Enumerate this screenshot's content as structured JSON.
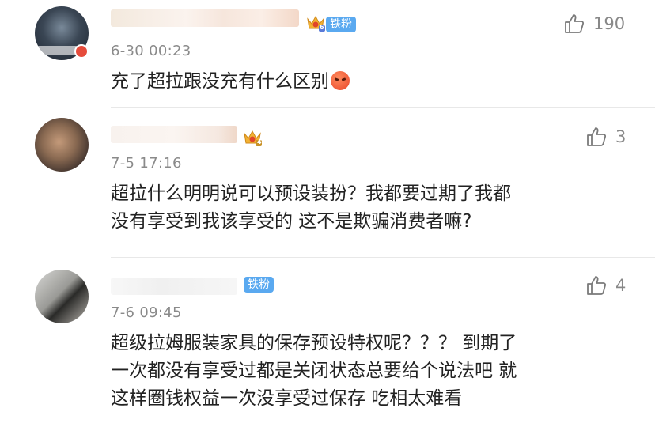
{
  "comments": [
    {
      "time": "6-30 00:23",
      "text_lines": [
        "充了超拉跟没充有什么区别"
      ],
      "badge_label": "铁粉",
      "crown_level": "6",
      "likes": "190",
      "emoji": "angry-emoji"
    },
    {
      "time": "7-5 17:16",
      "text_lines": [
        "超拉什么明明说可以预设装扮？我都要过期了我都",
        "没有享受到我该享受的 这不是欺骗消费者嘛?"
      ],
      "crown_level": "4",
      "likes": "3"
    },
    {
      "time": "7-6 09:45",
      "text_lines": [
        "超级拉姆服装家具的保存预设特权呢？？？  到期了",
        "一次都没有享受过都是关闭状态总要给个说法吧 就",
        "这样圈钱权益一次没享受过保存 吃相太难看"
      ],
      "badge_label": "铁粉",
      "likes": "4"
    }
  ],
  "colors": {
    "badge_blue": "#5aa9f0",
    "time_gray": "#8a8a8a",
    "text": "#222222",
    "crown_gold": "#f2b233"
  },
  "icons": {
    "like": "thumbs-up-icon",
    "crown": "crown-badge-icon"
  }
}
